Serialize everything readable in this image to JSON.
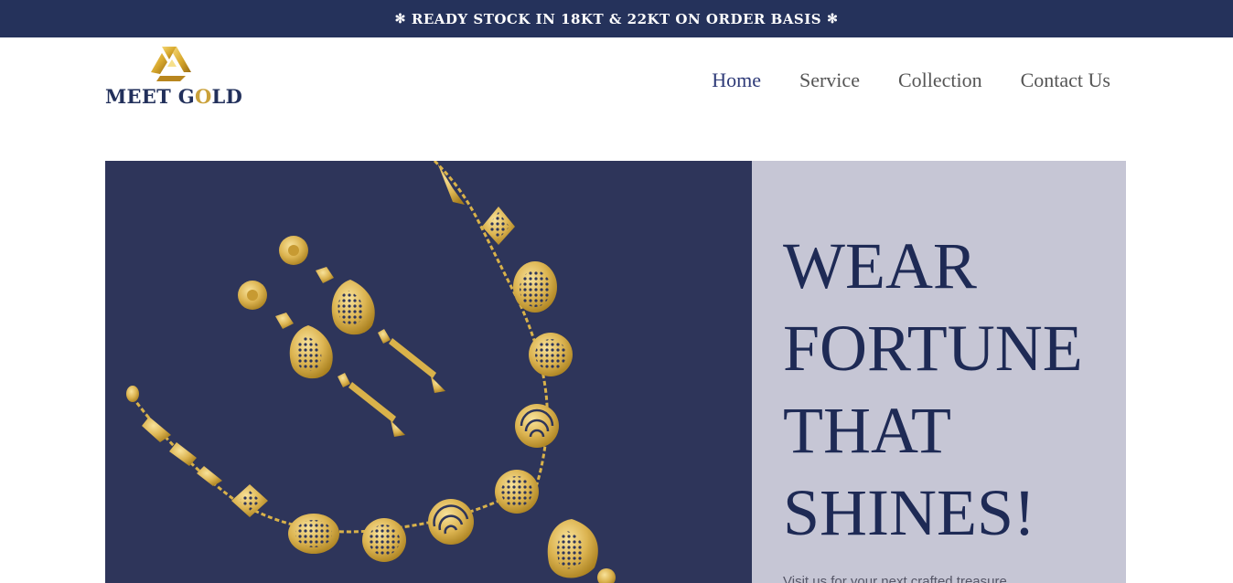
{
  "announcement": {
    "text": "READY STOCK IN 18KT & 22KT ON ORDER BASIS",
    "ornament": "✻"
  },
  "brand": {
    "name_part1": "MEET G",
    "name_o": "O",
    "name_part2": "LD",
    "icon": "gold-triangle-logo-icon"
  },
  "nav": {
    "items": [
      {
        "label": "Home",
        "active": true
      },
      {
        "label": "Service",
        "active": false
      },
      {
        "label": "Collection",
        "active": false
      },
      {
        "label": "Contact Us",
        "active": false
      }
    ]
  },
  "hero": {
    "title_lines": [
      "WEAR",
      "FORTUNE",
      "THAT",
      "SHINES!"
    ],
    "subtitle": "Visit us for your next crafted treasure",
    "image": "gold-necklace-and-earrings-image"
  },
  "colors": {
    "navy": "#25325b",
    "hero_panel": "#2e355a",
    "lavender": "#c6c6d5",
    "gold": "#d9b24a",
    "title": "#1e2a55"
  }
}
